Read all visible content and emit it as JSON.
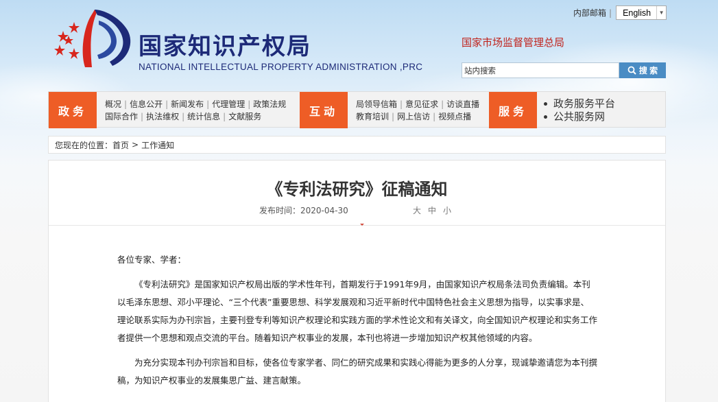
{
  "header": {
    "logo_cn": "国家知识产权局",
    "logo_en": "NATIONAL INTELLECTUAL PROPERTY ADMINISTRATION ,PRC",
    "top_links": {
      "mail": "内部邮箱",
      "language": "English"
    },
    "samr": "国家市场监督管理总局",
    "search": {
      "placeholder": "站内搜索",
      "button": "搜 索"
    }
  },
  "nav": {
    "gov": {
      "label": "政务",
      "row1": [
        "概况",
        "信息公开",
        "新闻发布",
        "代理管理",
        "政策法规"
      ],
      "row2": [
        "国际合作",
        "执法维权",
        "统计信息",
        "文献服务"
      ]
    },
    "interact": {
      "label": "互动",
      "row1": [
        "局领导信箱",
        "意见征求",
        "访谈直播"
      ],
      "row2": [
        "教育培训",
        "网上信访",
        "视频点播"
      ]
    },
    "service": {
      "label": "服务",
      "items": [
        "政务服务平台",
        "公共服务网"
      ]
    }
  },
  "breadcrumb": {
    "prefix": "您现在的位置：",
    "home": "首页",
    "separator": ">",
    "current": "工作通知"
  },
  "article": {
    "title": "《专利法研究》征稿通知",
    "date_label": "发布时间：2020-04-30",
    "font_sizes": [
      "大",
      "中",
      "小"
    ],
    "greeting": "各位专家、学者：",
    "para1": "《专利法研究》是国家知识产权局出版的学术性年刊，首期发行于1991年9月，由国家知识产权局条法司负责编辑。本刊以毛泽东思想、邓小平理论、“三个代表”重要思想、科学发展观和习近平新时代中国特色社会主义思想为指导，以实事求是、理论联系实际为办刊宗旨，主要刊登专利等知识产权理论和实践方面的学术性论文和有关译文，向全国知识产权理论和实务工作者提供一个思想和观点交流的平台。随着知识产权事业的发展，本刊也将进一步增加知识产权其他领域的内容。",
    "para2": "为充分实现本刊办刊宗旨和目标，使各位专家学者、同仁的研究成果和实践心得能为更多的人分享，现诚挚邀请您为本刊撰稿，为知识产权事业的发展集思广益、建言献策。"
  },
  "colors": {
    "nav_accent": "#ee5d26",
    "logo_blue": "#1d2a78",
    "samr_red": "#c0241d",
    "search_button": "#4a8cc4"
  }
}
